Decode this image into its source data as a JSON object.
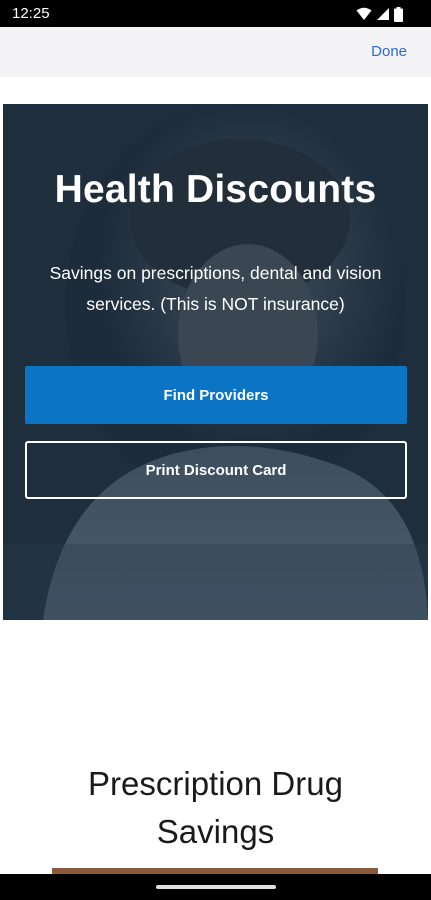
{
  "status_bar": {
    "time": "12:25",
    "icons": [
      "wifi-icon",
      "signal-icon",
      "battery-icon"
    ]
  },
  "header": {
    "done_label": "Done",
    "done_color": "#2b6ad6"
  },
  "hero": {
    "title": "Health Discounts",
    "subtitle": "Savings on prescriptions, dental and vision services. (This is NOT insurance)",
    "primary_button_label": "Find Providers",
    "primary_button_color": "#0b74c4",
    "secondary_button_label": "Print Discount Card"
  },
  "section": {
    "title": "Prescription Drug Savings"
  }
}
